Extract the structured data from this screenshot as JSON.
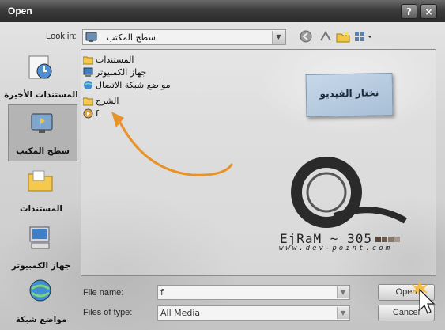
{
  "window": {
    "title": "Open",
    "help_glyph": "?",
    "close_glyph": "×"
  },
  "look_in": {
    "label": "Look in:",
    "value": "سطح المكتب"
  },
  "places": [
    {
      "label": "المستندات الأخيرة",
      "icon": "recent-documents-icon"
    },
    {
      "label": "سطح المكتب",
      "icon": "desktop-icon",
      "selected": true
    },
    {
      "label": "المستندات",
      "icon": "my-documents-icon"
    },
    {
      "label": "جهاز الكمبيوتر",
      "icon": "my-computer-icon"
    },
    {
      "label": "مواضع شبكة",
      "icon": "network-places-icon"
    }
  ],
  "files": [
    {
      "name": "المستندات",
      "icon": "documents-folder-icon"
    },
    {
      "name": "جهاز الكمبيوتر",
      "icon": "computer-icon"
    },
    {
      "name": "مواضع شبكة الاتصال",
      "icon": "network-icon"
    },
    {
      "name": "الشرح",
      "icon": "folder-icon"
    },
    {
      "name": "f",
      "icon": "media-file-icon"
    }
  ],
  "annotation": {
    "note_text": "نختار الفيديو",
    "arrow_color": "#e8922a"
  },
  "logo": {
    "brand": "EjRaM ~ 305",
    "site": "www.dev-point.com"
  },
  "file_name": {
    "label": "File name:",
    "value": "f"
  },
  "file_type": {
    "label": "Files of type:",
    "value": "All Media"
  },
  "buttons": {
    "open": "Open",
    "cancel": "Cancel"
  },
  "colors": {
    "titlebar": "#3c3c3c",
    "note": "#b8cbe0",
    "accent_arrow": "#e8922a"
  }
}
